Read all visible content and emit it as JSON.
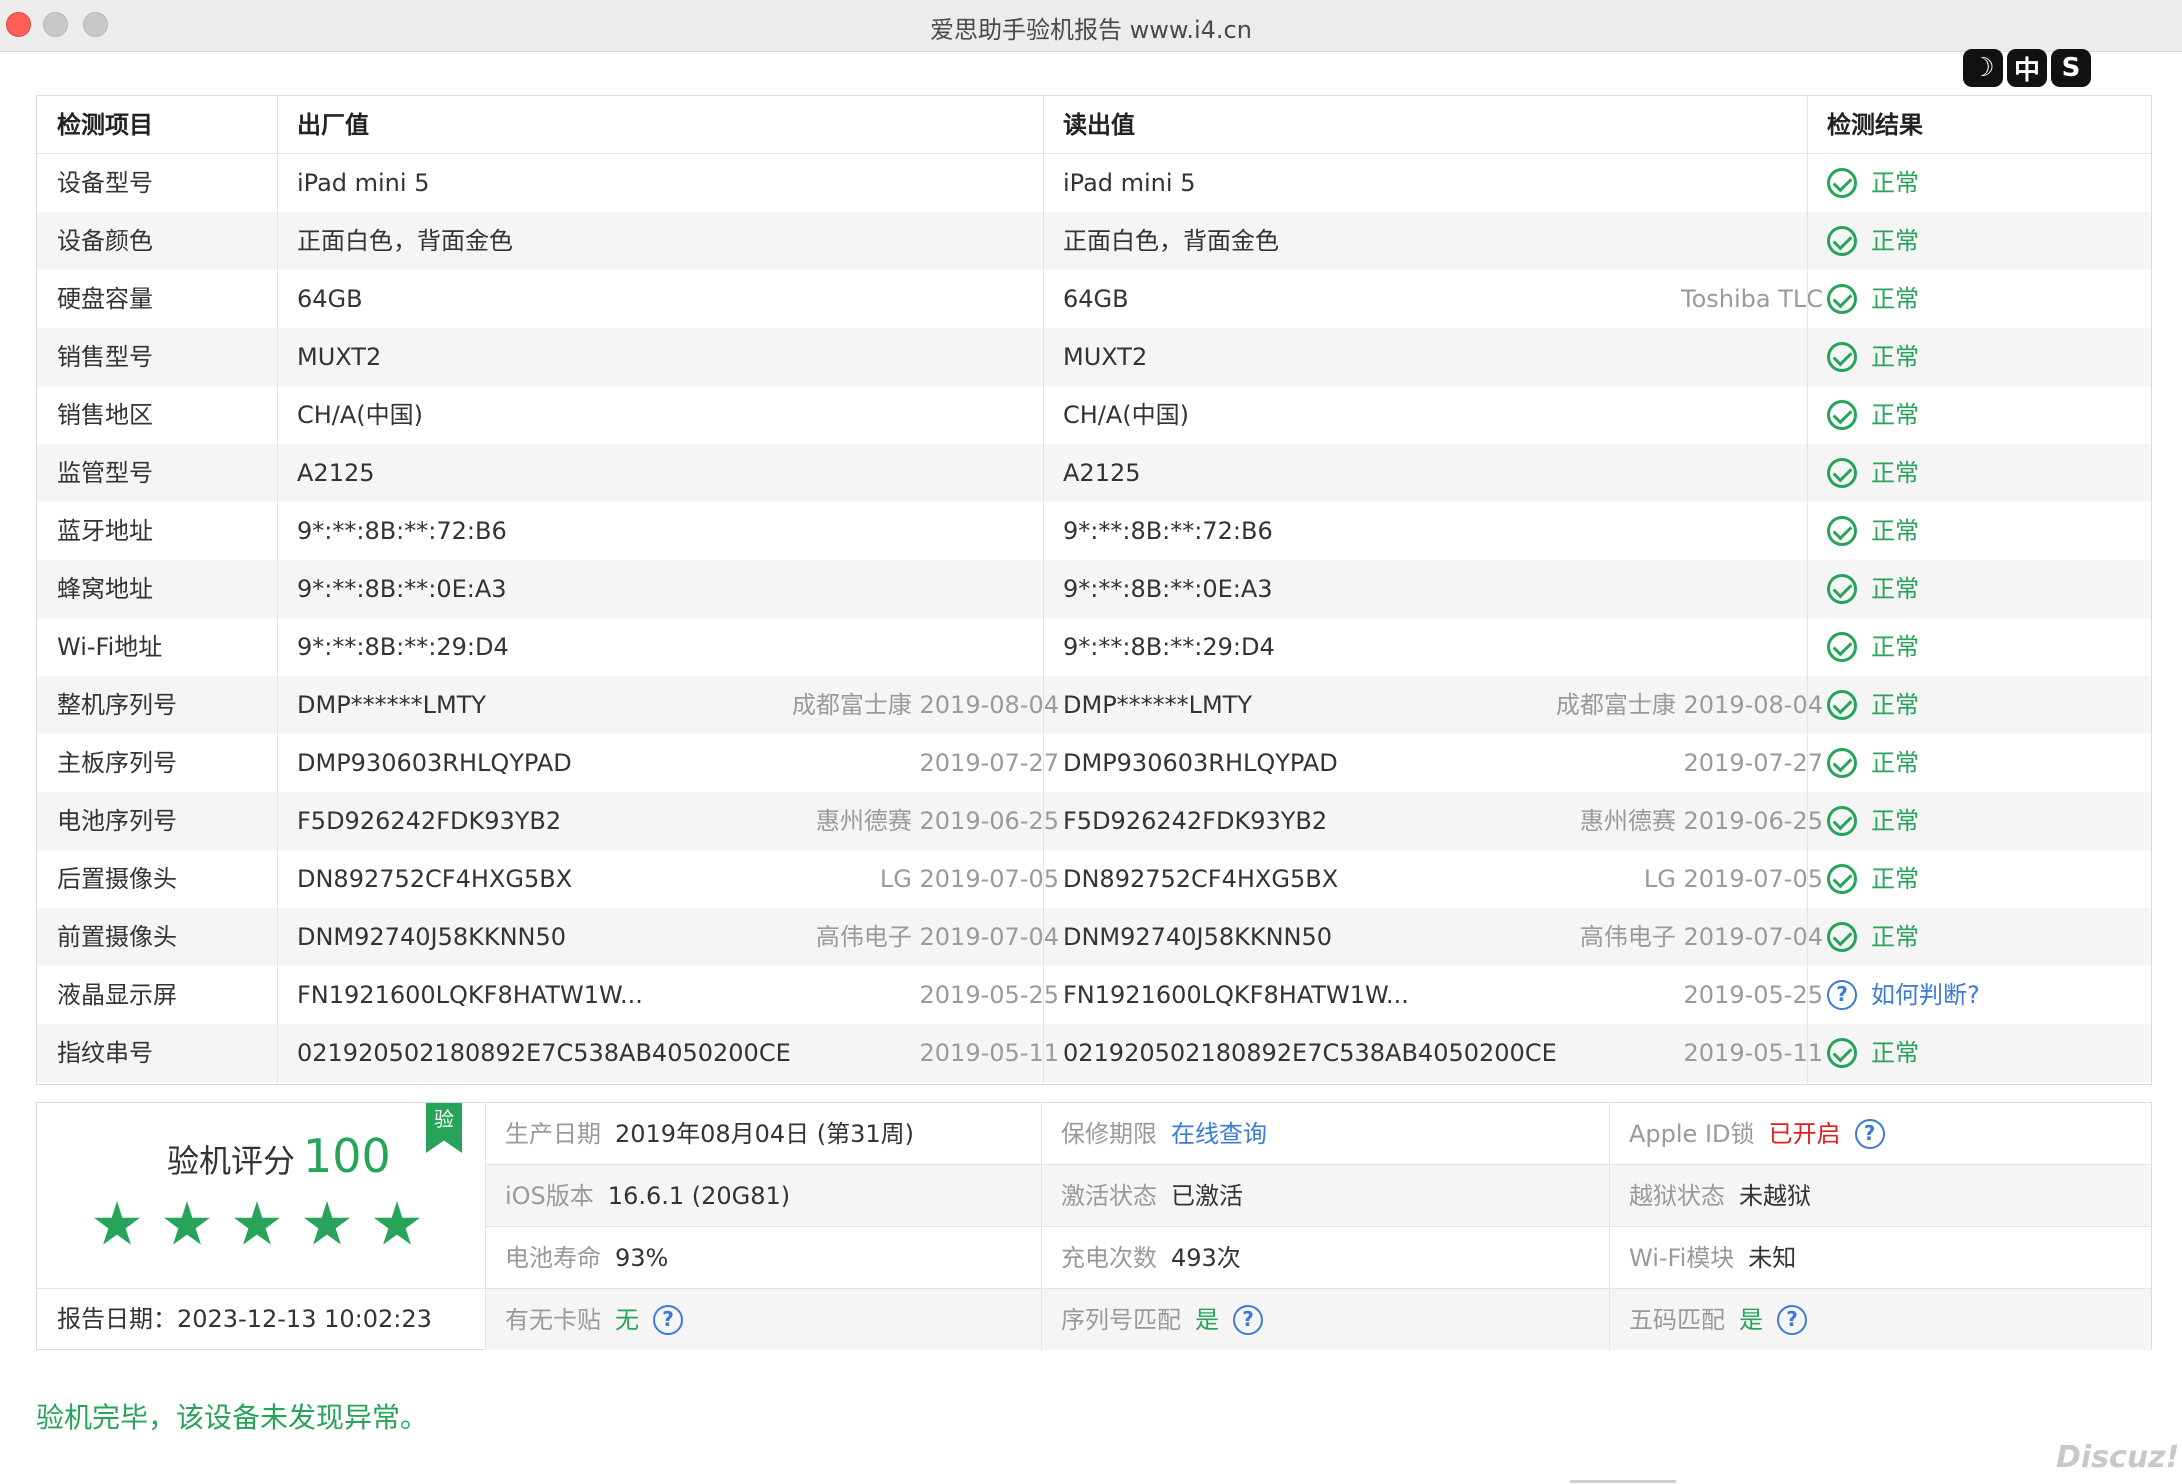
{
  "window": {
    "title": "爱思助手验机报告 www.i4.cn"
  },
  "top_badges": [
    "☽",
    "中",
    "S"
  ],
  "table": {
    "headers": [
      "检测项目",
      "出厂值",
      "读出值",
      "检测结果"
    ],
    "rows": [
      {
        "item": "设备型号",
        "factory": "iPad mini 5",
        "factory_sub": "",
        "read": "iPad mini 5",
        "read_sub": "",
        "result": "正常",
        "status": "ok"
      },
      {
        "item": "设备颜色",
        "factory": "正面白色，背面金色",
        "factory_sub": "",
        "read": "正面白色，背面金色",
        "read_sub": "",
        "result": "正常",
        "status": "ok"
      },
      {
        "item": "硬盘容量",
        "factory": "64GB",
        "factory_sub": "",
        "read": "64GB",
        "read_sub": "Toshiba TLC",
        "result": "正常",
        "status": "ok"
      },
      {
        "item": "销售型号",
        "factory": "MUXT2",
        "factory_sub": "",
        "read": "MUXT2",
        "read_sub": "",
        "result": "正常",
        "status": "ok"
      },
      {
        "item": "销售地区",
        "factory": "CH/A(中国)",
        "factory_sub": "",
        "read": "CH/A(中国)",
        "read_sub": "",
        "result": "正常",
        "status": "ok"
      },
      {
        "item": "监管型号",
        "factory": "A2125",
        "factory_sub": "",
        "read": "A2125",
        "read_sub": "",
        "result": "正常",
        "status": "ok"
      },
      {
        "item": "蓝牙地址",
        "factory": "9*:**:8B:**:72:B6",
        "factory_sub": "",
        "read": "9*:**:8B:**:72:B6",
        "read_sub": "",
        "result": "正常",
        "status": "ok"
      },
      {
        "item": "蜂窝地址",
        "factory": "9*:**:8B:**:0E:A3",
        "factory_sub": "",
        "read": "9*:**:8B:**:0E:A3",
        "read_sub": "",
        "result": "正常",
        "status": "ok"
      },
      {
        "item": "Wi-Fi地址",
        "factory": "9*:**:8B:**:29:D4",
        "factory_sub": "",
        "read": "9*:**:8B:**:29:D4",
        "read_sub": "",
        "result": "正常",
        "status": "ok"
      },
      {
        "item": "整机序列号",
        "factory": "DMP******LMTY",
        "factory_sub": "成都富士康 2019-08-04",
        "read": "DMP******LMTY",
        "read_sub": "成都富士康 2019-08-04",
        "result": "正常",
        "status": "ok"
      },
      {
        "item": "主板序列号",
        "factory": "DMP930603RHLQYPAD",
        "factory_sub": "2019-07-27",
        "read": "DMP930603RHLQYPAD",
        "read_sub": "2019-07-27",
        "result": "正常",
        "status": "ok"
      },
      {
        "item": "电池序列号",
        "factory": "F5D926242FDK93YB2",
        "factory_sub": "惠州德赛 2019-06-25",
        "read": "F5D926242FDK93YB2",
        "read_sub": "惠州德赛 2019-06-25",
        "result": "正常",
        "status": "ok"
      },
      {
        "item": "后置摄像头",
        "factory": "DN892752CF4HXG5BX",
        "factory_sub": "LG 2019-07-05",
        "read": "DN892752CF4HXG5BX",
        "read_sub": "LG 2019-07-05",
        "result": "正常",
        "status": "ok"
      },
      {
        "item": "前置摄像头",
        "factory": "DNM92740J58KKNN50",
        "factory_sub": "高伟电子 2019-07-04",
        "read": "DNM92740J58KKNN50",
        "read_sub": "高伟电子 2019-07-04",
        "result": "正常",
        "status": "ok"
      },
      {
        "item": "液晶显示屏",
        "factory": "FN1921600LQKF8HATW1W...",
        "factory_sub": "2019-05-25",
        "read": "FN1921600LQKF8HATW1W...",
        "read_sub": "2019-05-25",
        "result": "如何判断?",
        "status": "question"
      },
      {
        "item": "指纹串号",
        "factory": "021920502180892E7C538AB4050200CE",
        "factory_sub": "2019-05-11",
        "read": "021920502180892E7C538AB4050200CE",
        "read_sub": "2019-05-11",
        "result": "正常",
        "status": "ok"
      }
    ]
  },
  "summary": {
    "score_label": "验机评分",
    "score": "100",
    "badge": "验",
    "stars": 5,
    "report_date": "报告日期：2023-12-13 10:02:23",
    "production_label": "生产日期",
    "production_value": "2019年08月04日 (第31周)",
    "warranty_label": "保修期限",
    "warranty_value": "在线查询",
    "appleid_label": "Apple ID锁",
    "appleid_value": "已开启",
    "ios_label": "iOS版本",
    "ios_value": "16.6.1 (20G81)",
    "activation_label": "激活状态",
    "activation_value": "已激活",
    "jailbreak_label": "越狱状态",
    "jailbreak_value": "未越狱",
    "battery_label": "电池寿命",
    "battery_value": "93%",
    "charge_label": "充电次数",
    "charge_value": "493次",
    "wifi_label": "Wi-Fi模块",
    "wifi_value": "未知",
    "simtray_label": "有无卡贴",
    "simtray_value": "无",
    "serialmatch_label": "序列号匹配",
    "serialmatch_value": "是",
    "fivecode_label": "五码匹配",
    "fivecode_value": "是"
  },
  "footer_message": "验机完毕，该设备未发现异常。",
  "watermark": "Discuz!",
  "colors": {
    "green": "#27a35a",
    "blue": "#3a7bd5",
    "red": "#e02020"
  }
}
